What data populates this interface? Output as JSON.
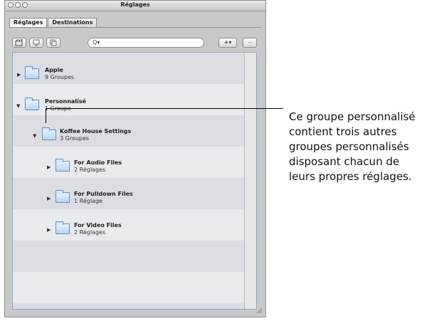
{
  "window": {
    "title": "Réglages"
  },
  "tabs": [
    {
      "label": "Réglages"
    },
    {
      "label": "Destinations"
    }
  ],
  "toolbar": {
    "search_icon_label": "Q▾",
    "add_menu_label": "+▾",
    "remove_label": "−"
  },
  "tree": {
    "apple": {
      "name": "Apple",
      "sub": "9 Groupes"
    },
    "personnalise": {
      "name": "Personnalisé",
      "sub": "1 Groupe"
    },
    "koffee": {
      "name": "Koffee House Settings",
      "sub": "3 Groupes"
    },
    "audio": {
      "name": "For Audio Files",
      "sub": "2 Réglages"
    },
    "pulldown": {
      "name": "For Pulldown Files",
      "sub": "1 Réglage"
    },
    "video": {
      "name": "For Video Files",
      "sub": "2 Réglages"
    }
  },
  "callout": {
    "text": "Ce groupe personnalisé contient trois autres groupes personnalisés disposant chacun de leurs propres réglages."
  },
  "colors": {
    "panel_border": "#8ba7cf",
    "folder_blue": "#5f8fc3"
  },
  "icons": [
    "new-group-icon",
    "new-setting-icon",
    "duplicate-icon",
    "search-icon",
    "add-menu-icon",
    "remove-icon",
    "disclosure-triangle-icon",
    "folder-icon",
    "resize-grip-icon"
  ]
}
